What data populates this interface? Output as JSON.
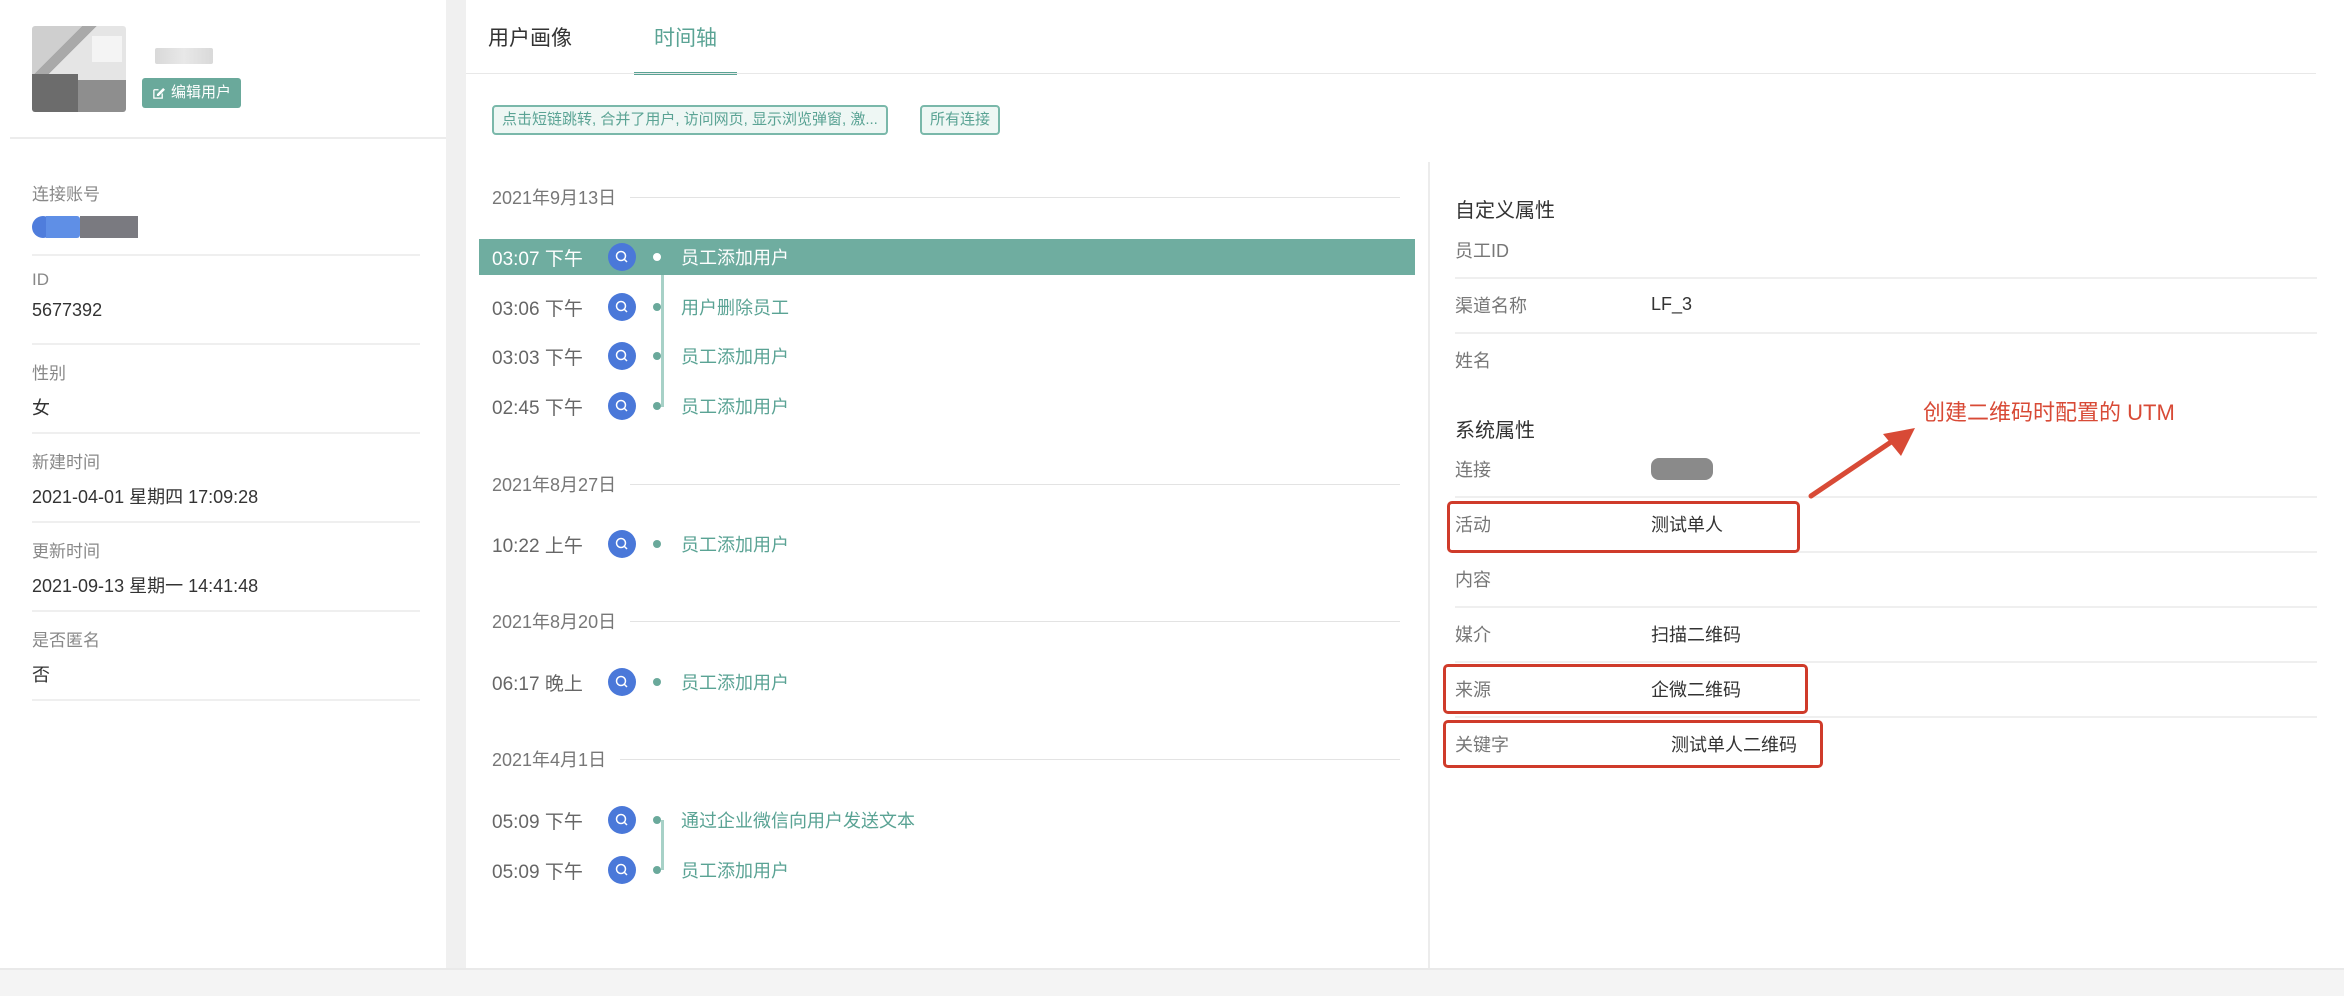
{
  "profile": {
    "edit_button": "编辑用户",
    "fields": [
      {
        "label": "连接账号",
        "value": ""
      },
      {
        "label": "ID",
        "value": "5677392"
      },
      {
        "label": "性别",
        "value": "女"
      },
      {
        "label": "新建时间",
        "value": "2021-04-01 星期四 17:09:28"
      },
      {
        "label": "更新时间",
        "value": "2021-09-13 星期一 14:41:48"
      },
      {
        "label": "是否匿名",
        "value": "否"
      }
    ]
  },
  "tabs": [
    {
      "label": "用户画像",
      "active": false
    },
    {
      "label": "时间轴",
      "active": true
    }
  ],
  "filters": {
    "events": "点击短链跳转, 合并了用户, 访问网页, 显示浏览弹窗, 激...",
    "connections": "所有连接"
  },
  "timeline": [
    {
      "date": "2021年9月13日",
      "events": [
        {
          "time": "03:07 下午",
          "text": "员工添加用户",
          "active": true
        },
        {
          "time": "03:06 下午",
          "text": "用户删除员工",
          "active": false
        },
        {
          "time": "03:03 下午",
          "text": "员工添加用户",
          "active": false
        },
        {
          "time": "02:45 下午",
          "text": "员工添加用户",
          "active": false
        }
      ]
    },
    {
      "date": "2021年8月27日",
      "events": [
        {
          "time": "10:22 上午",
          "text": "员工添加用户",
          "active": false
        }
      ]
    },
    {
      "date": "2021年8月20日",
      "events": [
        {
          "time": "06:17 晚上",
          "text": "员工添加用户",
          "active": false
        }
      ]
    },
    {
      "date": "2021年4月1日",
      "events": [
        {
          "time": "05:09 下午",
          "text": "通过企业微信向用户发送文本",
          "active": false
        },
        {
          "time": "05:09 下午",
          "text": "员工添加用户",
          "active": false
        }
      ]
    }
  ],
  "details": {
    "custom_title": "自定义属性",
    "custom": [
      {
        "key": "员工ID",
        "value": ""
      },
      {
        "key": "渠道名称",
        "value": "LF_3"
      },
      {
        "key": "姓名",
        "value": ""
      }
    ],
    "system_title": "系统属性",
    "system": [
      {
        "key": "连接",
        "value": ""
      },
      {
        "key": "活动",
        "value": "测试单人"
      },
      {
        "key": "内容",
        "value": ""
      },
      {
        "key": "媒介",
        "value": "扫描二维码"
      },
      {
        "key": "来源",
        "value": "企微二维码"
      },
      {
        "key": "关键字",
        "value": "测试单人二维码"
      }
    ]
  },
  "annotation": "创建二维码时配置的 UTM",
  "colors": {
    "accent": "#5aa394",
    "active_row": "#6fada0",
    "channel_icon": "#4a78d9",
    "highlight": "#cf3b2a"
  },
  "icons": {
    "edit": "edit-icon",
    "channel": "wechat-work-icon"
  }
}
